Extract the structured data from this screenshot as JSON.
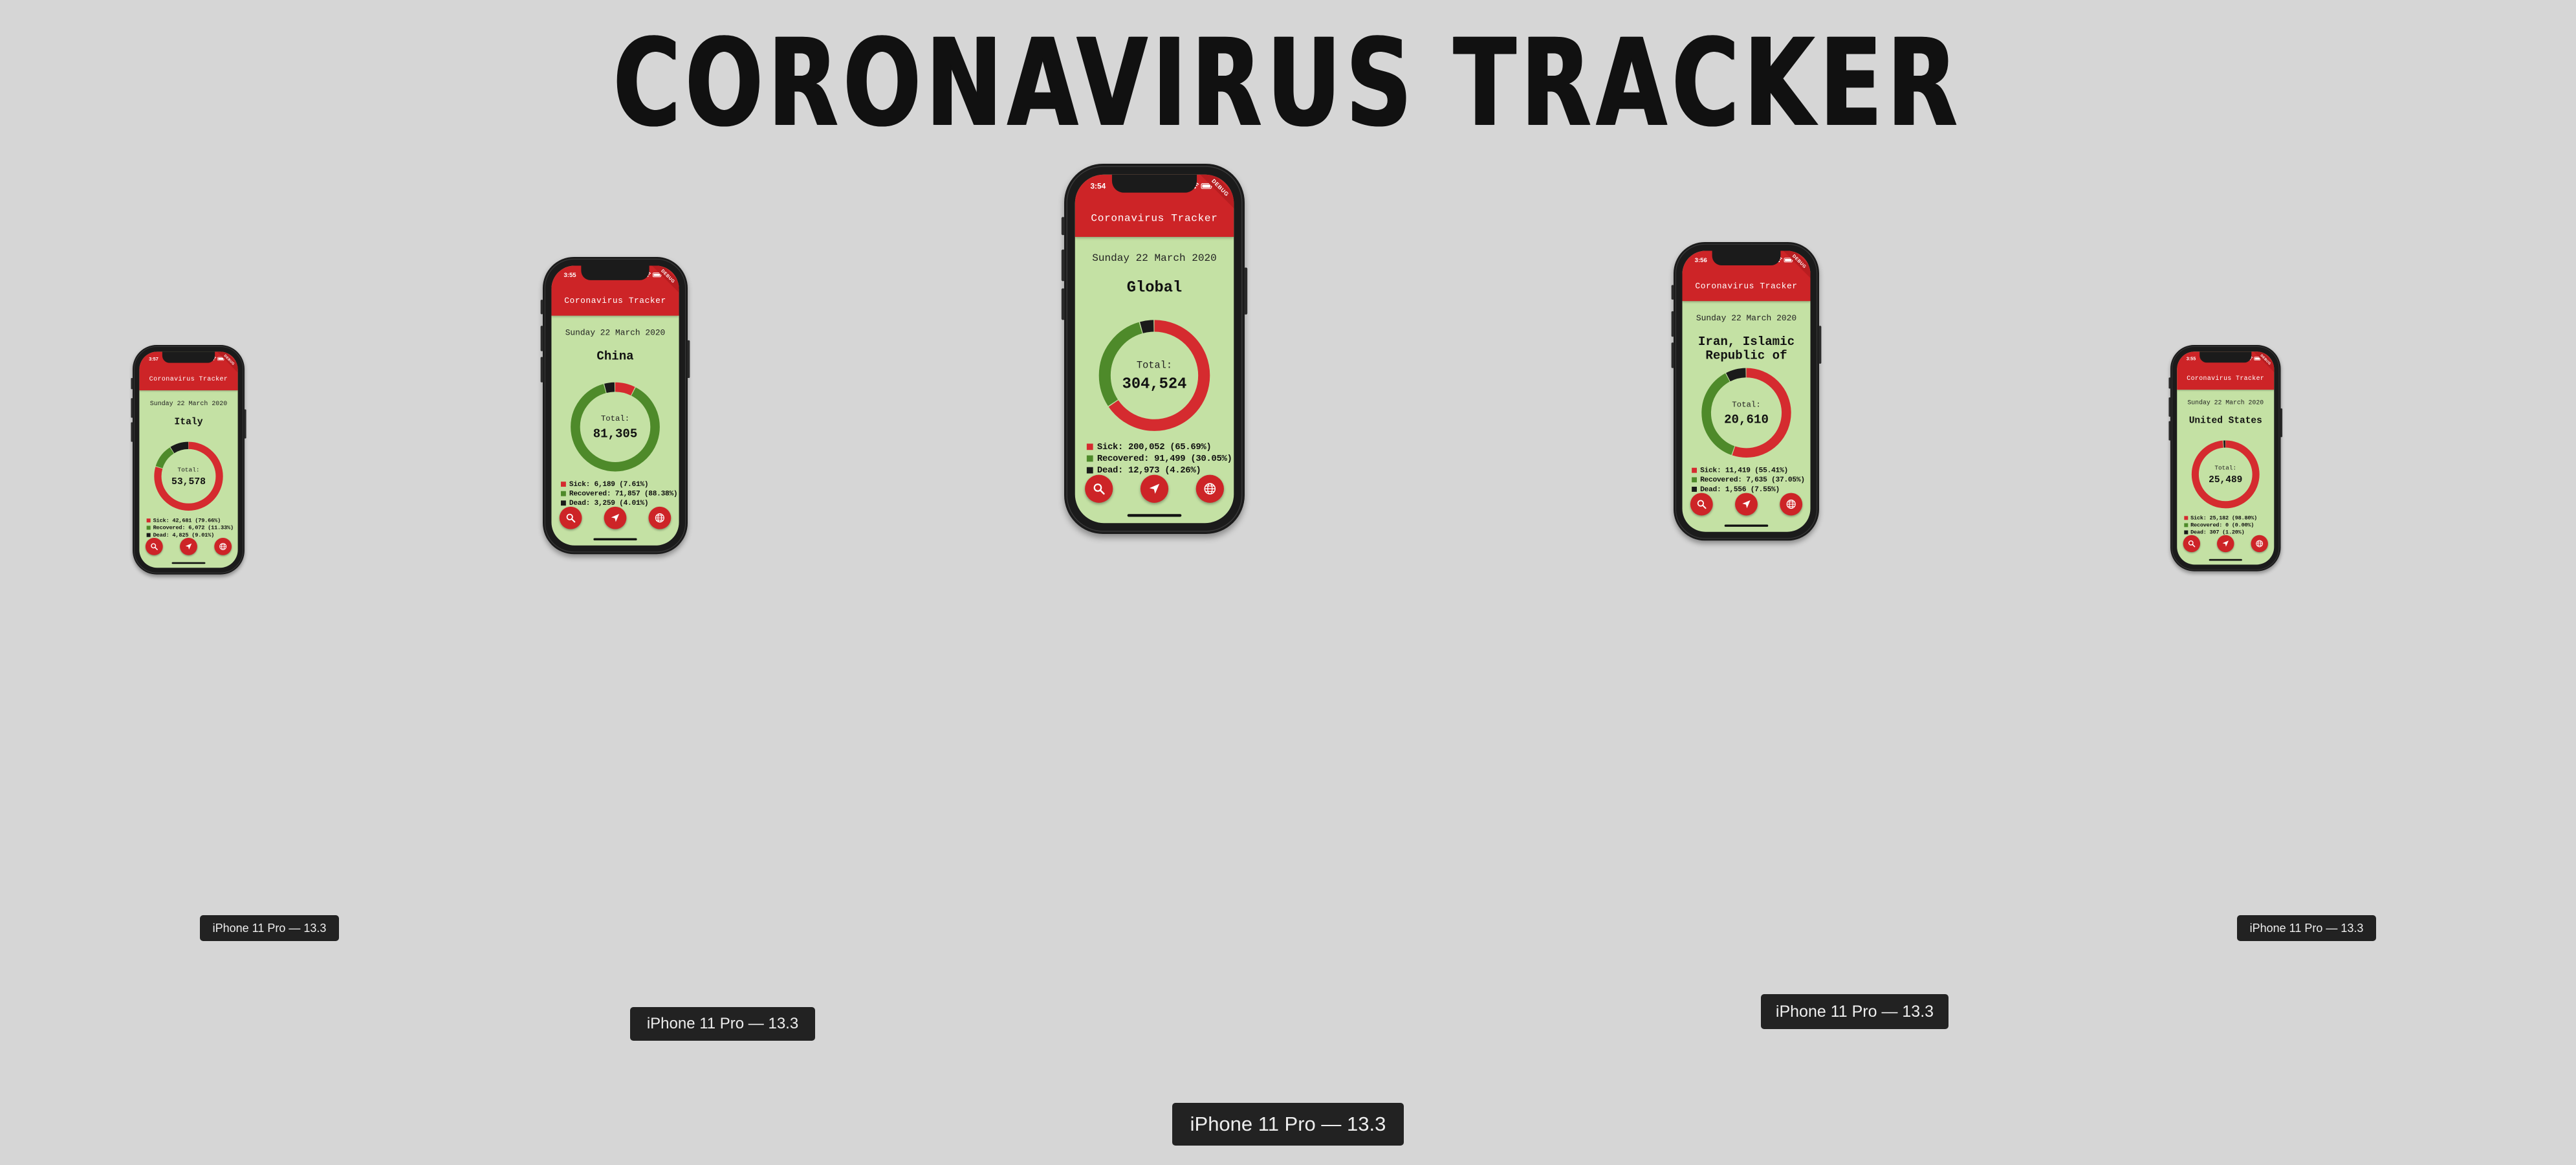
{
  "page_title": "CORONAVIRUS TRACKER",
  "colors": {
    "sick": "#d52b2f",
    "recovered": "#4e8a2a",
    "dead": "#1a1a1a",
    "app_bar": "#cd2427",
    "screen_bg": "#c4e1a4"
  },
  "phones": [
    {
      "time": "3:57",
      "debug_badge": "DEBUG",
      "app_title": "Coronavirus Tracker",
      "date": "Sunday 22 March 2020",
      "region": "Italy",
      "total_label": "Total:",
      "total": "53,578",
      "breakdown": {
        "sick": 42681,
        "recovered": 6072,
        "dead": 4825
      },
      "legend": [
        "Sick: 42,681 (79.66%)",
        "Recovered: 6,072 (11.33%)",
        "Dead: 4,825 (9.01%)"
      ],
      "device_label": "iPhone 11 Pro — 13.3"
    },
    {
      "time": "3:55",
      "debug_badge": "DEBUG",
      "app_title": "Coronavirus Tracker",
      "date": "Sunday 22 March 2020",
      "region": "China",
      "total_label": "Total:",
      "total": "81,305",
      "breakdown": {
        "sick": 6189,
        "recovered": 71857,
        "dead": 3259
      },
      "legend": [
        "Sick: 6,189 (7.61%)",
        "Recovered: 71,857 (88.38%)",
        "Dead: 3,259 (4.01%)"
      ],
      "device_label": "iPhone 11 Pro — 13.3"
    },
    {
      "time": "3:54",
      "debug_badge": "DEBUG",
      "app_title": "Coronavirus Tracker",
      "date": "Sunday 22 March 2020",
      "region": "Global",
      "total_label": "Total:",
      "total": "304,524",
      "breakdown": {
        "sick": 200052,
        "recovered": 91499,
        "dead": 12973
      },
      "legend": [
        "Sick: 200,052 (65.69%)",
        "Recovered: 91,499 (30.05%)",
        "Dead: 12,973 (4.26%)"
      ],
      "device_label": "iPhone 11 Pro — 13.3"
    },
    {
      "time": "3:56",
      "debug_badge": "DEBUG",
      "app_title": "Coronavirus Tracker",
      "date": "Sunday 22 March 2020",
      "region": "Iran, Islamic Republic of",
      "total_label": "Total:",
      "total": "20,610",
      "breakdown": {
        "sick": 11419,
        "recovered": 7635,
        "dead": 1556
      },
      "legend": [
        "Sick: 11,419 (55.41%)",
        "Recovered: 7,635 (37.05%)",
        "Dead: 1,556 (7.55%)"
      ],
      "device_label": "iPhone 11 Pro — 13.3"
    },
    {
      "time": "3:55",
      "debug_badge": "DEBUG",
      "app_title": "Coronavirus Tracker",
      "date": "Sunday 22 March 2020",
      "region": "United States",
      "total_label": "Total:",
      "total": "25,489",
      "breakdown": {
        "sick": 25182,
        "recovered": 0,
        "dead": 307
      },
      "legend": [
        "Sick: 25,182 (98.80%)",
        "Recovered: 0 (0.00%)",
        "Dead: 307 (1.20%)"
      ],
      "device_label": "iPhone 11 Pro — 13.3"
    }
  ],
  "fab_icons": [
    "search-icon",
    "navigation-arrow-icon",
    "globe-icon"
  ]
}
